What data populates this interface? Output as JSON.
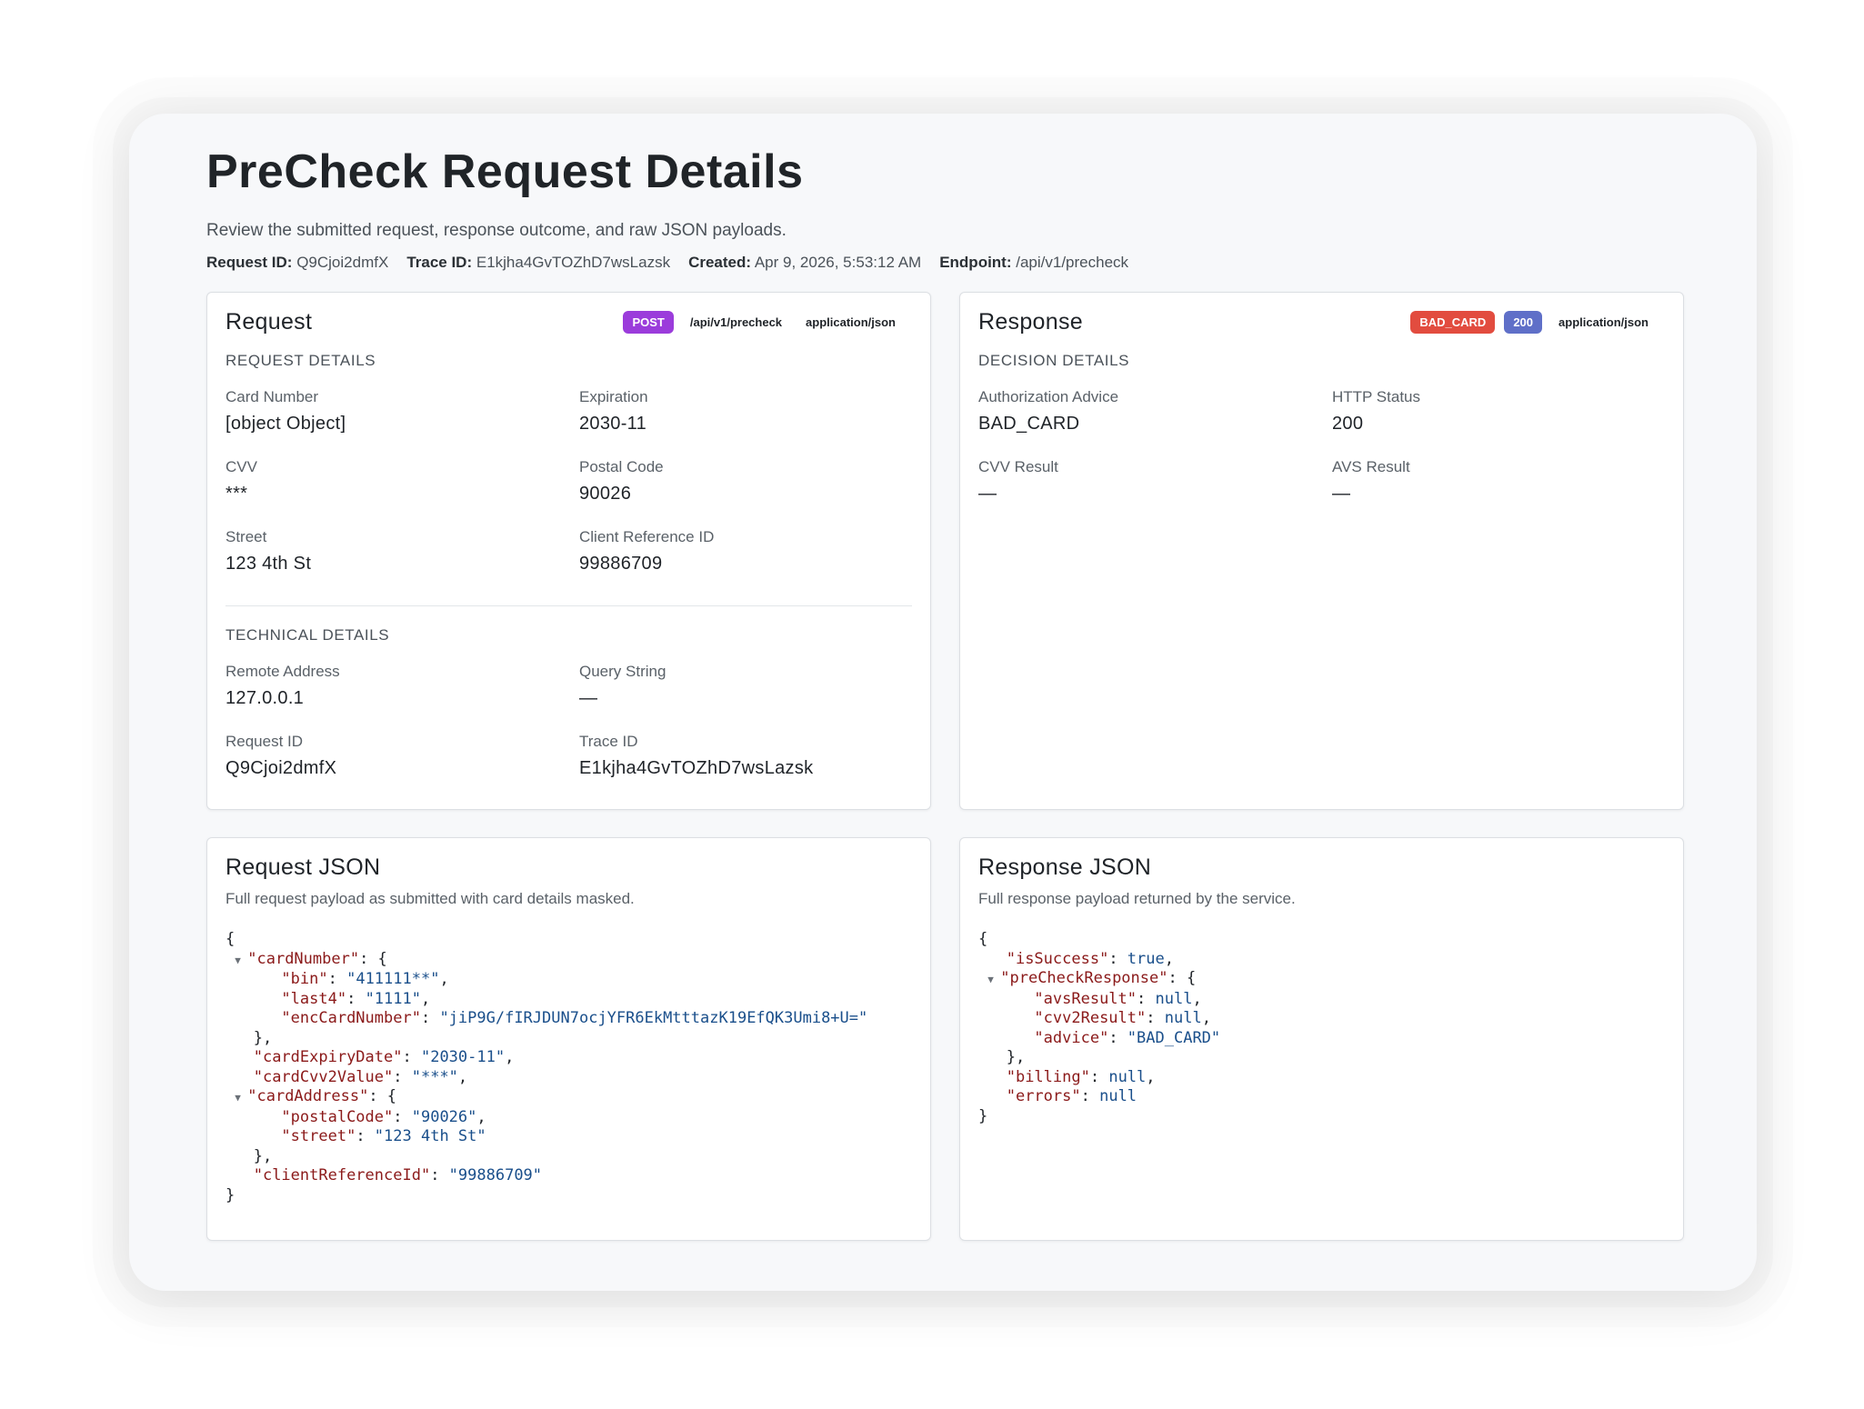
{
  "page": {
    "title": "PreCheck Request Details",
    "subtitle": "Review the submitted request, response outcome, and raw JSON payloads.",
    "meta": [
      {
        "label": "Request ID:",
        "value": "Q9Cjoi2dmfX"
      },
      {
        "label": "Trace ID:",
        "value": "E1kjha4GvTOZhD7wsLazsk"
      },
      {
        "label": "Created:",
        "value": "Apr 9, 2026, 5:53:12 AM"
      },
      {
        "label": "Endpoint:",
        "value": "/api/v1/precheck"
      }
    ]
  },
  "request": {
    "title": "Request",
    "badges": {
      "method": "POST",
      "path": "/api/v1/precheck",
      "content_type": "application/json"
    },
    "details_label": "REQUEST DETAILS",
    "fields": [
      {
        "label": "Card Number",
        "value": "[object Object]"
      },
      {
        "label": "Expiration",
        "value": "2030-11"
      },
      {
        "label": "CVV",
        "value": "***"
      },
      {
        "label": "Postal Code",
        "value": "90026"
      },
      {
        "label": "Street",
        "value": "123 4th St"
      },
      {
        "label": "Client Reference ID",
        "value": "99886709"
      }
    ],
    "technical_label": "TECHNICAL DETAILS",
    "technical": [
      {
        "label": "Remote Address",
        "value": "127.0.0.1"
      },
      {
        "label": "Query String",
        "value": "—"
      },
      {
        "label": "Request ID",
        "value": "Q9Cjoi2dmfX"
      },
      {
        "label": "Trace ID",
        "value": "E1kjha4GvTOZhD7wsLazsk"
      }
    ]
  },
  "response": {
    "title": "Response",
    "badges": {
      "advice": "BAD_CARD",
      "status": "200",
      "content_type": "application/json"
    },
    "details_label": "DECISION DETAILS",
    "fields": [
      {
        "label": "Authorization Advice",
        "value": "BAD_CARD"
      },
      {
        "label": "HTTP Status",
        "value": "200"
      },
      {
        "label": "CVV Result",
        "value": "—"
      },
      {
        "label": "AVS Result",
        "value": "—"
      }
    ]
  },
  "request_json": {
    "title": "Request JSON",
    "subtitle": "Full request payload as submitted with card details masked.",
    "lines": {
      "open": "{",
      "cardNumber_key": "\"cardNumber\"",
      "bin_key": "\"bin\"",
      "bin_val": "\"411111**\"",
      "last4_key": "\"last4\"",
      "last4_val": "\"1111\"",
      "enc_key": "\"encCardNumber\"",
      "enc_val": "\"jiP9G/fIRJDUN7ocjYFR6EkMtttazK19EfQK3Umi8+U=\"",
      "expiry_key": "\"cardExpiryDate\"",
      "expiry_val": "\"2030-11\"",
      "cvv_key": "\"cardCvv2Value\"",
      "cvv_val": "\"***\"",
      "address_key": "\"cardAddress\"",
      "postal_key": "\"postalCode\"",
      "postal_val": "\"90026\"",
      "street_key": "\"street\"",
      "street_val": "\"123 4th St\"",
      "clientref_key": "\"clientReferenceId\"",
      "clientref_val": "\"99886709\"",
      "close": "}"
    }
  },
  "response_json": {
    "title": "Response JSON",
    "subtitle": "Full response payload returned by the service.",
    "lines": {
      "open": "{",
      "success_key": "\"isSuccess\"",
      "success_val": "true",
      "precheck_key": "\"preCheckResponse\"",
      "avs_key": "\"avsResult\"",
      "avs_val": "null",
      "cvv2_key": "\"cvv2Result\"",
      "cvv2_val": "null",
      "advice_key": "\"advice\"",
      "advice_val": "\"BAD_CARD\"",
      "billing_key": "\"billing\"",
      "billing_val": "null",
      "errors_key": "\"errors\"",
      "errors_val": "null",
      "close": "}"
    }
  },
  "icons": {
    "collapse": "caret-down-icon"
  },
  "colors": {
    "post": "#9b3cdb",
    "bad_card": "#e24c3f",
    "status": "#5f6fc8",
    "json_key": "#8b1a1a",
    "json_value": "#1a4f8b"
  }
}
